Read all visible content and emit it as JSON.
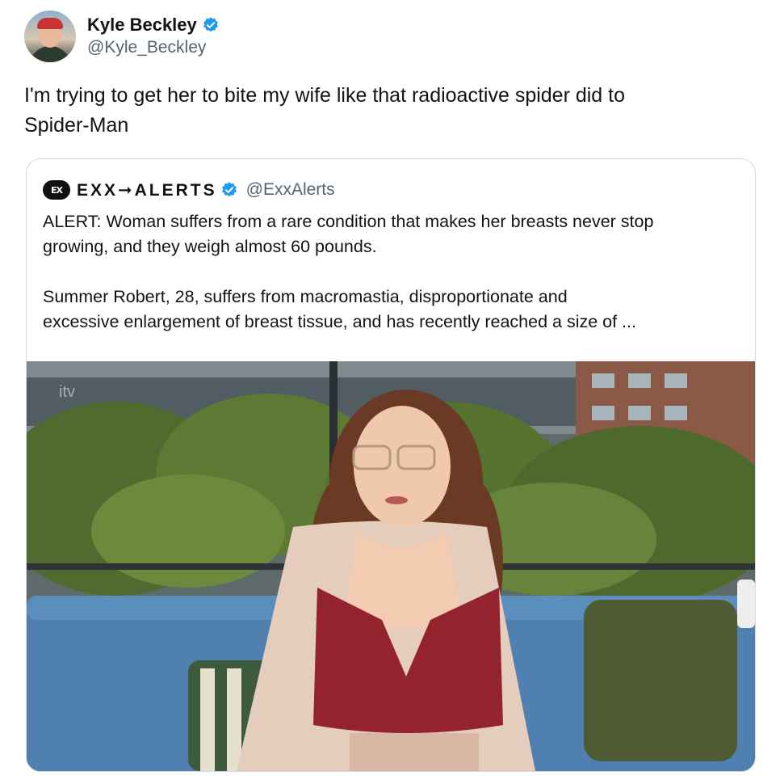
{
  "tweet": {
    "display_name": "Kyle Beckley",
    "handle": "@Kyle_Beckley",
    "verified_icon": "verified-badge-icon",
    "text": "I'm trying to get her to bite my wife like that radioactive spider did to\nSpider-Man"
  },
  "quote": {
    "logo_text": "EX",
    "display_name": "EXX➞ALERTS",
    "handle": "@ExxAlerts",
    "text": "ALERT: Woman suffers from a rare condition that makes her breasts never stop\ngrowing, and they weigh almost 60 pounds.\n\nSummer Robert, 28, suffers from macromastia, disproportionate and\nexcessive enlargement of breast tissue, and has recently reached a size of ...",
    "media": {
      "broadcaster_logo": "itv",
      "description_icon": "tv-interview-photo"
    }
  },
  "colors": {
    "verified": "#1d9bf0",
    "handle": "#536471",
    "border": "#cfd9de"
  }
}
